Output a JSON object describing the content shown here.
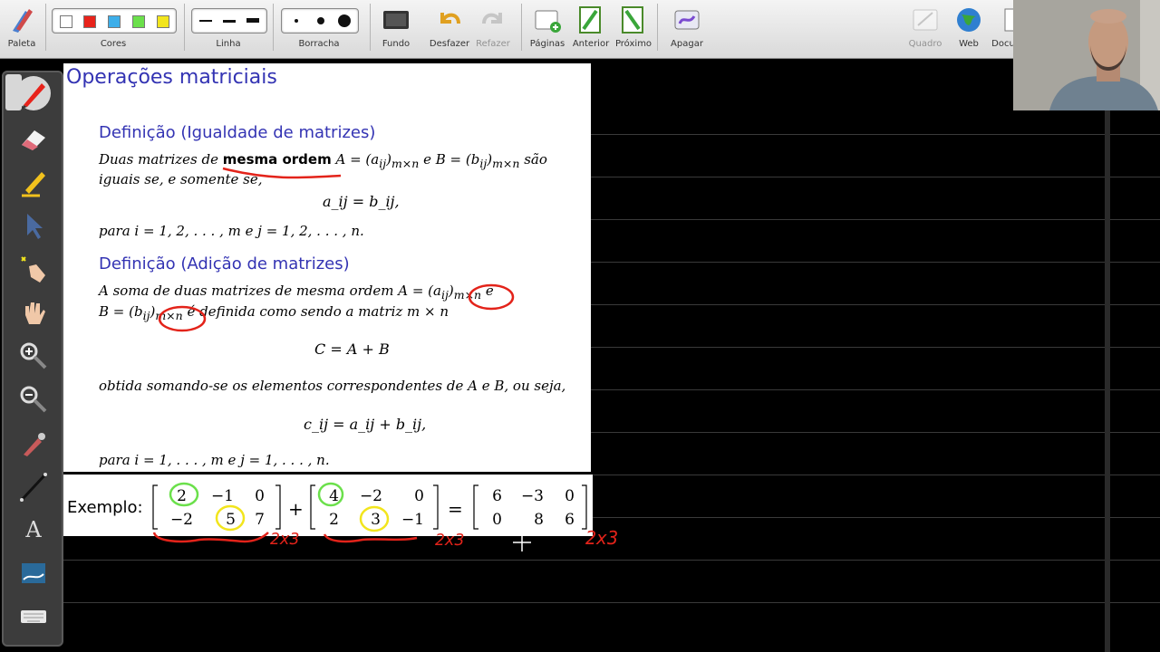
{
  "toolbar": {
    "paleta": "Paleta",
    "cores": "Cores",
    "linha": "Linha",
    "borracha": "Borracha",
    "fundo": "Fundo",
    "desfazer": "Desfazer",
    "refazer": "Refazer",
    "paginas": "Páginas",
    "anterior": "Anterior",
    "proximo": "Próximo",
    "apagar": "Apagar",
    "quadro": "Quadro",
    "web": "Web",
    "docu": "Docu",
    "colors": [
      "#ffffff",
      "#e8231b",
      "#3daee9",
      "#6be04b",
      "#f2e51d"
    ]
  },
  "slide": {
    "title": "Operações matriciais",
    "def1_title": "Definição (Igualdade de matrizes)",
    "def1_line1_a": "Duas matrizes de ",
    "def1_line1_bold": "mesma ordem",
    "def1_line1_b": " A = (a",
    "def1_line1_sub1": "ij",
    "def1_line1_sub2": "m×n",
    "def1_line1_c": " e B = (b",
    "def1_line1_d": " são",
    "def1_line2": "iguais se, e somente se,",
    "def1_eq": "a_ij = b_ij,",
    "def1_range": "para i = 1, 2, . . . , m e j = 1, 2, . . . , n.",
    "def2_title": "Definição (Adição de matrizes)",
    "def2_line1": "A soma de duas matrizes de mesma ordem A = (a",
    "def2_line1_end": "e",
    "def2_line2_a": "B = (b",
    "def2_line2_b": "é definida como sendo a matriz m × n",
    "def2_eq": "C = A + B",
    "def2_line3": "obtida somando-se os elementos correspondentes de A e B, ou seja,",
    "def2_eq2": "c_ij = a_ij + b_ij,",
    "def2_range": "para i = 1, . . . , m e j = 1, . . . , n."
  },
  "example": {
    "label": "Exemplo:",
    "A": [
      [
        "2",
        "−1",
        "0"
      ],
      [
        "−2",
        "5",
        "7"
      ]
    ],
    "B": [
      [
        "4",
        "−2",
        "0"
      ],
      [
        "2",
        "3",
        "−1"
      ]
    ],
    "C": [
      [
        "6",
        "−3",
        "0"
      ],
      [
        "0",
        "8",
        "6"
      ]
    ],
    "plus": "+",
    "equals": "=",
    "anno_a": "2x3",
    "anno_b": "2x3",
    "anno_c": "2x3"
  }
}
